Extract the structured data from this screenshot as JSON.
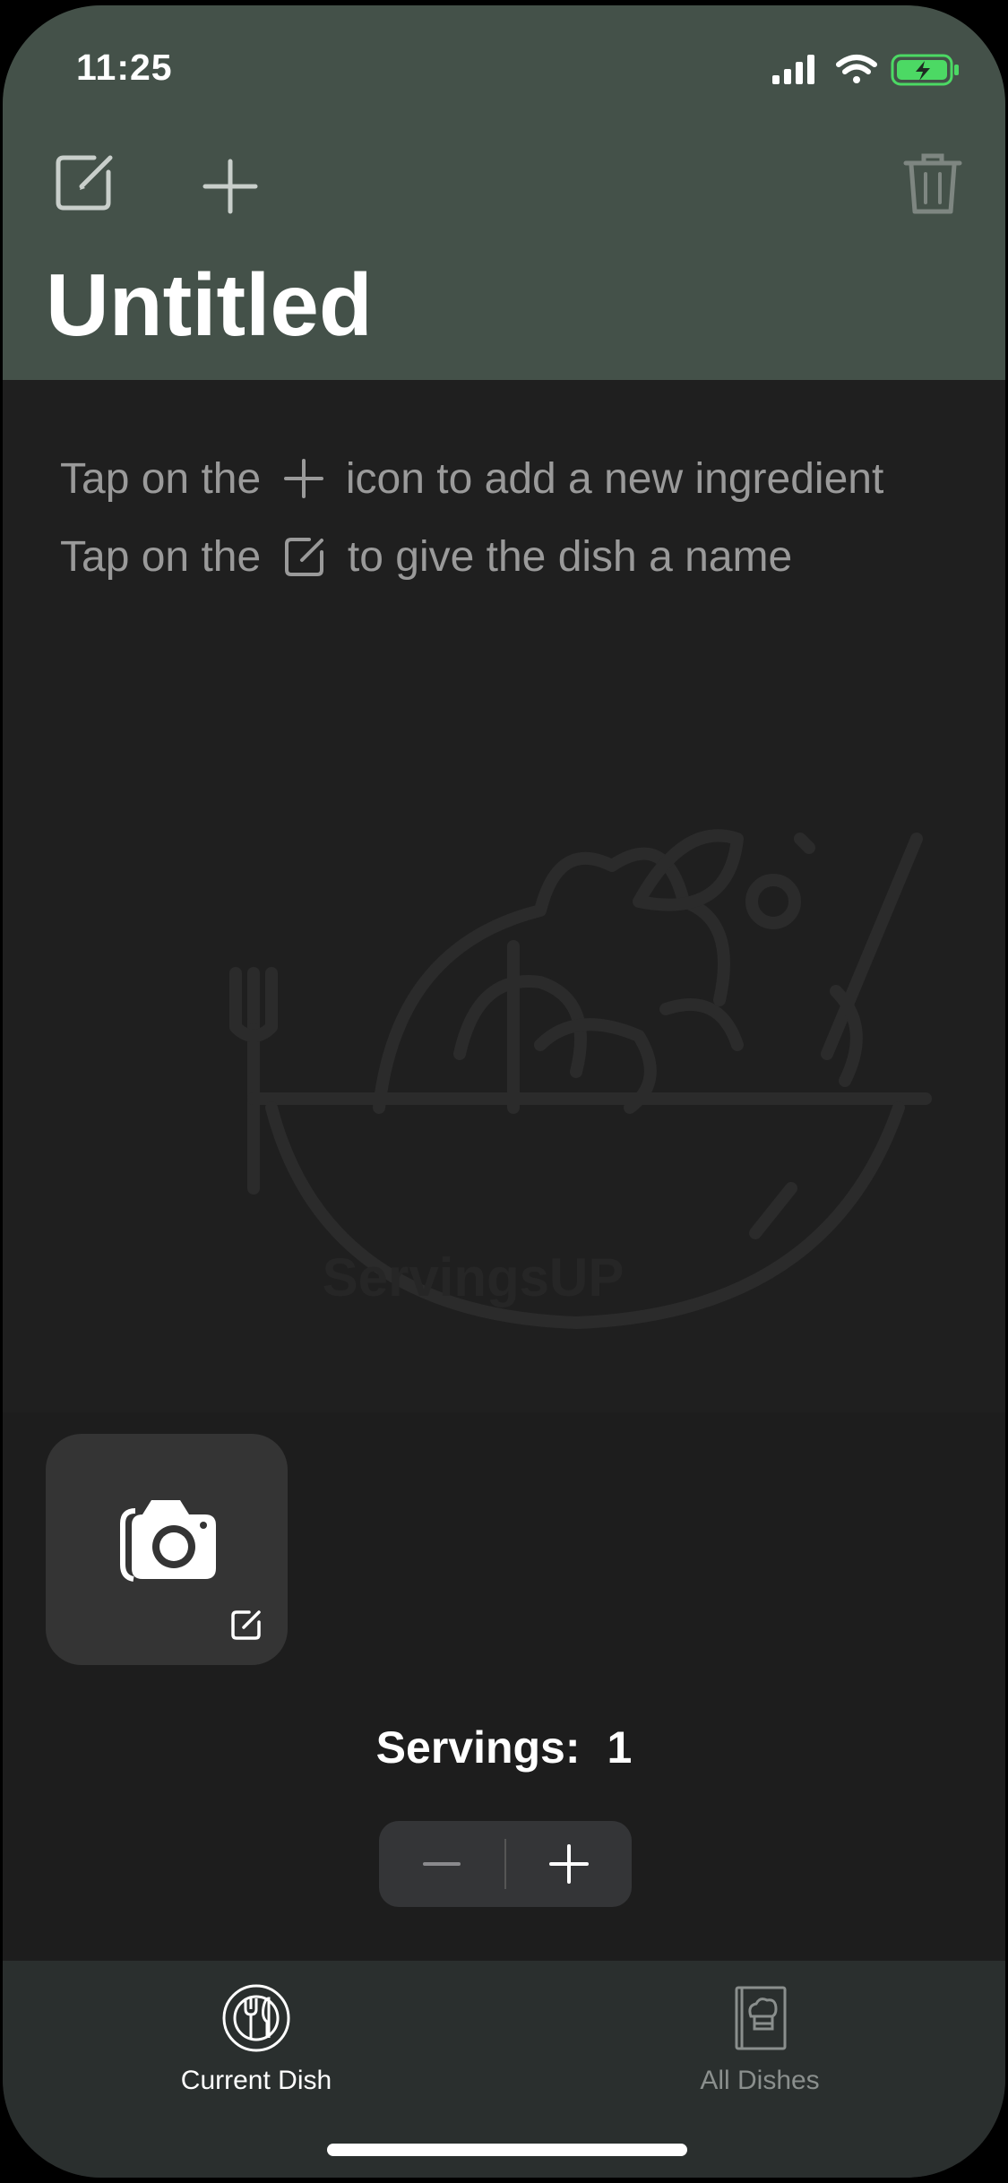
{
  "status_bar": {
    "time": "11:25"
  },
  "toolbar": {
    "edit_icon": "square-pencil-icon",
    "add_icon": "plus-icon",
    "delete_icon": "trash-icon"
  },
  "dish": {
    "title": "Untitled"
  },
  "hints": {
    "line1_pre": "Tap on the",
    "line1_post": "icon to add a new ingredient",
    "line2_pre": "Tap on the",
    "line2_post": "to give the dish a name"
  },
  "watermark": {
    "text": "ServingsUP"
  },
  "servings": {
    "label": "Servings:",
    "value": "1"
  },
  "tabs": [
    {
      "label": "Current Dish",
      "icon": "plate-cutlery-icon",
      "selected": true
    },
    {
      "label": "All Dishes",
      "icon": "recipe-book-icon",
      "selected": false
    }
  ],
  "colors": {
    "header_bg": "#445149",
    "body_bg": "#1f1f1f",
    "tabbar_bg": "#2a2f2e",
    "battery_green": "#4cd964",
    "hint_text": "#9a9a9a"
  }
}
